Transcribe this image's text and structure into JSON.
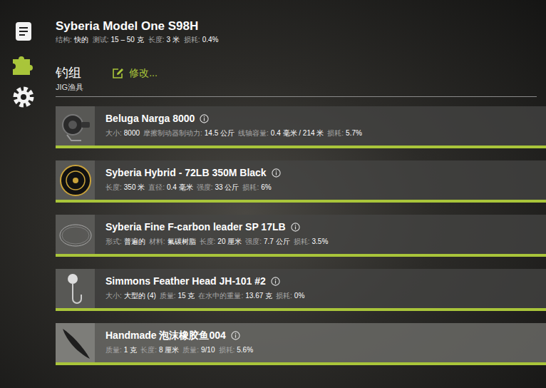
{
  "sidebar": {
    "items": [
      {
        "kind": "document",
        "selected": false
      },
      {
        "kind": "puzzle",
        "selected": true
      },
      {
        "kind": "gear",
        "selected": false
      }
    ]
  },
  "rod": {
    "title": "Syberia Model One S98H",
    "specs": [
      {
        "label": "结构:",
        "value": "快的"
      },
      {
        "label": "测试:",
        "value": "15 – 50 克"
      },
      {
        "label": "长度:",
        "value": "3 米"
      },
      {
        "label": "损耗:",
        "value": "0.4%"
      }
    ]
  },
  "rig": {
    "title": "钓组",
    "subtitle": "JIG渔具",
    "edit": "修改..."
  },
  "items": [
    {
      "kind": "reel",
      "name": "Beluga Narga 8000",
      "highlighted": false,
      "level": 1,
      "specs": [
        {
          "label": "大小:",
          "value": "8000"
        },
        {
          "label": "摩擦制动器制动力:",
          "value": "14.5 公斤"
        },
        {
          "label": "线轴容量:",
          "value": "0.4 毫米 / 214 米"
        },
        {
          "label": "损耗:",
          "value": "5.7%"
        }
      ]
    },
    {
      "kind": "line",
      "name": "Syberia Hybrid - 72LB 350M Black",
      "highlighted": false,
      "level": 1,
      "specs": [
        {
          "label": "长度:",
          "value": "350 米"
        },
        {
          "label": "直径:",
          "value": "0.4 毫米"
        },
        {
          "label": "强度:",
          "value": "33 公斤"
        },
        {
          "label": "损耗:",
          "value": "6%"
        }
      ]
    },
    {
      "kind": "leader",
      "name": "Syberia Fine F-carbon leader SP 17LB",
      "highlighted": false,
      "level": 1,
      "specs": [
        {
          "label": "形式:",
          "value": "普遍的"
        },
        {
          "label": "材料:",
          "value": "氟碳树脂"
        },
        {
          "label": "长度:",
          "value": "20 厘米"
        },
        {
          "label": "强度:",
          "value": "7.7 公斤"
        },
        {
          "label": "损耗:",
          "value": "3.5%"
        }
      ]
    },
    {
      "kind": "jig",
      "name": "Simmons Feather Head JH-101 #2",
      "highlighted": false,
      "level": 1,
      "specs": [
        {
          "label": "大小:",
          "value": "大型的 (4)"
        },
        {
          "label": "质量:",
          "value": "15 克"
        },
        {
          "label": "在水中的重量:",
          "value": "13.67 克"
        },
        {
          "label": "损耗:",
          "value": "0%"
        }
      ]
    },
    {
      "kind": "lure",
      "name": "Handmade 泡沫橡胶鱼004",
      "highlighted": true,
      "level": 1,
      "specs": [
        {
          "label": "质量:",
          "value": "1 克"
        },
        {
          "label": "长度:",
          "value": "8 厘米"
        },
        {
          "label": "质量:",
          "value": "9/10"
        },
        {
          "label": "损耗:",
          "value": "5.6%"
        }
      ]
    }
  ]
}
